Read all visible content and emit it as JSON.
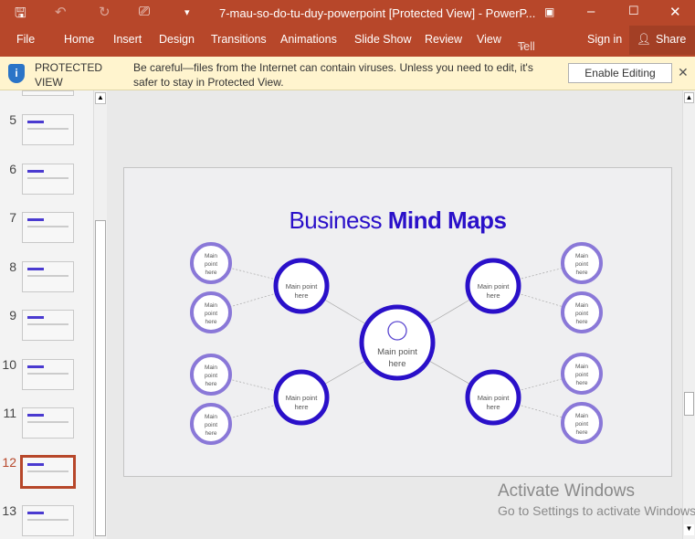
{
  "titlebar": {
    "title": "7-mau-so-do-tu-duy-powerpoint [Protected View] - PowerP..."
  },
  "ribbon": {
    "tabs": [
      "File",
      "Home",
      "Insert",
      "Design",
      "Transitions",
      "Animations",
      "Slide Show",
      "Review",
      "View"
    ],
    "tell_me": "Tell me...",
    "sign_in": "Sign in",
    "share": "Share"
  },
  "protected": {
    "label_line1": "PROTECTED",
    "label_line2": "VIEW",
    "message_line1": "Be careful—files from the Internet can contain viruses. Unless you need to edit, it's",
    "message_line2": "safer to stay in Protected View.",
    "enable_button": "Enable Editing"
  },
  "thumbnails": {
    "numbers": [
      "5",
      "6",
      "7",
      "8",
      "9",
      "10",
      "11",
      "12",
      "13"
    ],
    "selected": "12"
  },
  "slide": {
    "title_regular": "Business ",
    "title_bold": "Mind Maps",
    "center_line1": "Main point",
    "center_line2": "here",
    "mid_line1": "Main point",
    "mid_line2": "here",
    "small_line1": "Main",
    "small_line2": "point",
    "small_line3": "here"
  },
  "watermark": {
    "line1": "Activate Windows",
    "line2": "Go to Settings to activate Windows."
  },
  "colors": {
    "accent": "#b7472a",
    "deep_blue": "#2a10c9",
    "light_purple": "#8a78d8"
  }
}
